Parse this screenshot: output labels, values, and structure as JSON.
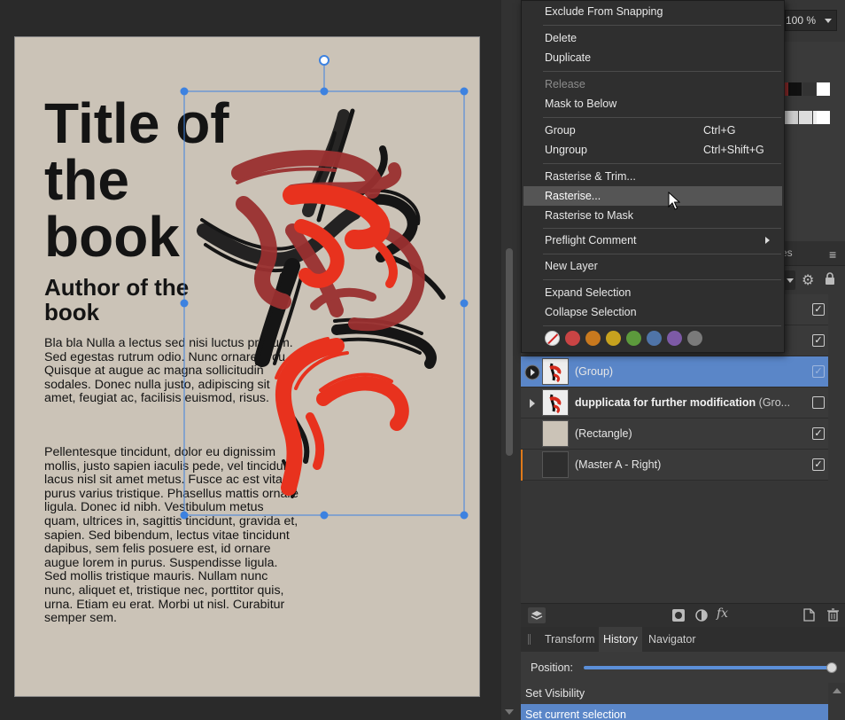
{
  "document": {
    "title": "Title of the book",
    "author": "Author of the book",
    "para1": "Bla bla Nulla a lectus sed nisi luctus pretium. Sed egestas rutrum odio. Nunc ornare arcu. Quisque at augue ac magna sollicitudin sodales. Donec nulla justo, adipiscing sit amet, feugiat ac, facilisis euismod, risus.",
    "para2": "Pellentesque tincidunt, dolor eu dignissim mollis, justo sapien iaculis pede, vel tincidunt lacus nisl sit amet metus. Fusce ac est vitae purus varius tristique. Phasellus mattis ornare ligula. Donec id nibh. Vestibulum metus quam, ultrices in, sagittis tincidunt, gravida et, sapien. Sed bibendum, lectus vitae tincidunt dapibus, sem felis posuere est, id ornare augue lorem in purus. Suspendisse ligula. Sed mollis tristique mauris. Nullam nunc nunc, aliquet et, tristique nec, porttitor quis, urna. Etiam eu erat. Morbi ut nisl. Curabitur semper sem."
  },
  "zoom": {
    "value": "100 %"
  },
  "layers_panel": {
    "tab_partial": "es",
    "rows": [
      {
        "name": "(Group)",
        "bold": false,
        "selected": true,
        "checked": true
      },
      {
        "name": "dupplicata for further modification",
        "suffix": "(Gro...",
        "bold": true,
        "selected": false,
        "checked": false
      },
      {
        "name": "(Rectangle)",
        "bold": false,
        "selected": false,
        "checked": true
      },
      {
        "name": "(Master A - Right)",
        "bold": false,
        "selected": false,
        "checked": true
      }
    ]
  },
  "history_panel": {
    "tabs": [
      "Transform",
      "History",
      "Navigator"
    ],
    "active_tab": "History",
    "position_label": "Position:",
    "position_value": 1.0,
    "items": [
      "Set Visibility",
      "Set current selection"
    ]
  },
  "context_menu": {
    "items": {
      "exclude_snapping": "Exclude From Snapping",
      "delete": "Delete",
      "duplicate": "Duplicate",
      "release": "Release",
      "mask_below": "Mask to Below",
      "group": "Group",
      "group_shortcut": "Ctrl+G",
      "ungroup": "Ungroup",
      "ungroup_shortcut": "Ctrl+Shift+G",
      "rasterise_trim": "Rasterise & Trim...",
      "rasterise": "Rasterise...",
      "rasterise_mask": "Rasterise to Mask",
      "preflight": "Preflight Comment",
      "new_layer": "New Layer",
      "expand_selection": "Expand Selection",
      "collapse_selection": "Collapse Selection"
    },
    "tag_colors": [
      "#c94444",
      "#c8791e",
      "#c7a21e",
      "#5c9a3c",
      "#4f74a8",
      "#7d5aa6",
      "#7a7a7a"
    ]
  },
  "colors": {
    "accent": "#5a86c8",
    "page": "#cbc3b7",
    "selection": "#3d82e0",
    "brush_red": "#e8321e",
    "brush_dark_red": "#9a3030",
    "brush_black": "#151515"
  }
}
